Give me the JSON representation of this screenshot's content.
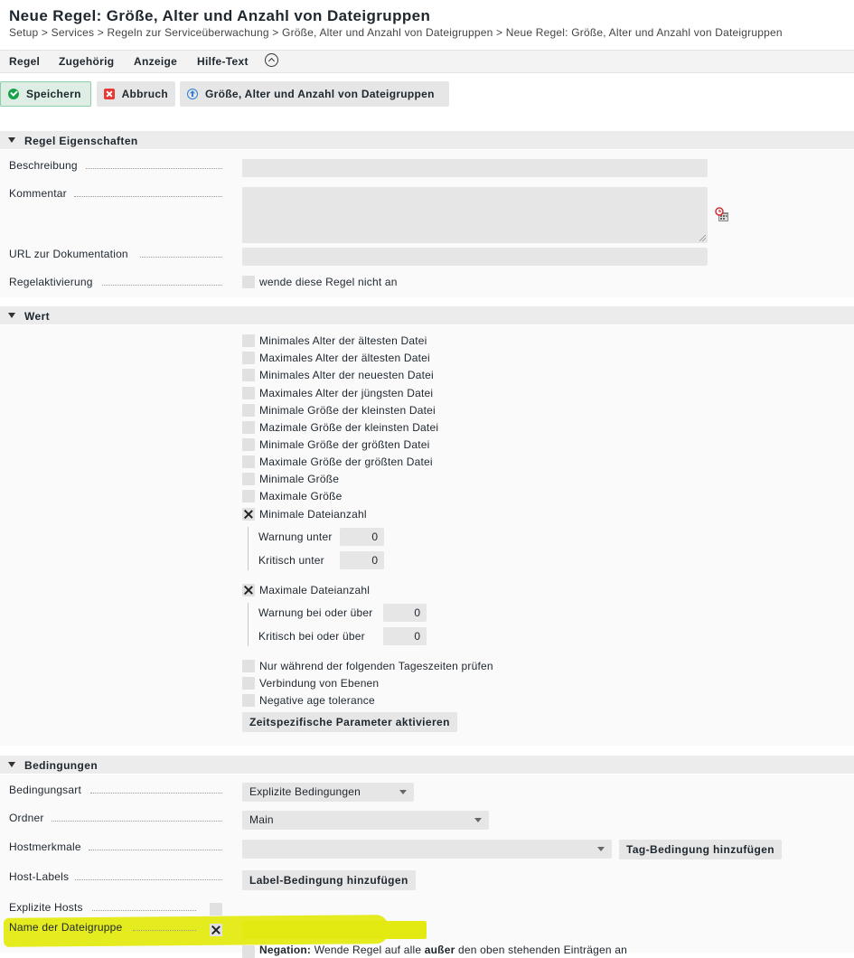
{
  "page": {
    "title": "Neue Regel: Größe, Alter und Anzahl von Dateigruppen",
    "breadcrumb": "Setup > Services > Regeln zur Serviceüberwachung > Größe, Alter und Anzahl von Dateigruppen > Neue Regel: Größe, Alter und Anzahl von Dateigruppen"
  },
  "menu": {
    "items": [
      "Regel",
      "Zugehörig",
      "Anzeige",
      "Hilfe-Text"
    ]
  },
  "toolbar": {
    "save_label": "Speichern",
    "cancel_label": "Abbruch",
    "parent_label": "Größe, Alter und Anzahl von Dateigruppen"
  },
  "properties": {
    "header": "Regel Eigenschaften",
    "description_label": "Beschreibung",
    "description_value": "",
    "comment_label": "Kommentar",
    "comment_value": "",
    "url_label": "URL zur Dokumentation",
    "url_value": "",
    "activation_label": "Regelaktivierung",
    "activation_checkbox": "wende diese Regel nicht an"
  },
  "value": {
    "header": "Wert",
    "options": [
      {
        "label": "Minimales Alter der ältesten Datei",
        "checked": false
      },
      {
        "label": "Maximales Alter der ältesten Datei",
        "checked": false
      },
      {
        "label": "Minimales Alter der neuesten Datei",
        "checked": false
      },
      {
        "label": "Maximales Alter der jüngsten Datei",
        "checked": false
      },
      {
        "label": "Minimale Größe der kleinsten Datei",
        "checked": false
      },
      {
        "label": "Mazimale Größe der kleinsten Datei",
        "checked": false
      },
      {
        "label": "Minimale Größe der größten Datei",
        "checked": false
      },
      {
        "label": "Maximale Größe der größten Datei",
        "checked": false
      },
      {
        "label": "Minimale Größe",
        "checked": false
      },
      {
        "label": "Maximale Größe",
        "checked": false
      }
    ],
    "min_count": {
      "label": "Minimale Dateianzahl",
      "checked": true,
      "warn_label": "Warnung unter",
      "warn_value": "0",
      "crit_label": "Kritisch unter",
      "crit_value": "0"
    },
    "max_count": {
      "label": "Maximale Dateianzahl",
      "checked": true,
      "warn_label": "Warnung bei oder über",
      "warn_value": "0",
      "crit_label": "Kritisch bei oder über",
      "crit_value": "0"
    },
    "extra_options": [
      {
        "label": "Nur während der folgenden Tageszeiten prüfen",
        "checked": false
      },
      {
        "label": "Verbindung von Ebenen",
        "checked": false
      },
      {
        "label": "Negative age tolerance",
        "checked": false
      }
    ],
    "timespecific_button": "Zeitspezifische Parameter aktivieren"
  },
  "conditions": {
    "header": "Bedingungen",
    "type_label": "Bedingungsart",
    "type_value": "Explizite Bedingungen",
    "folder_label": "Ordner",
    "folder_value": "Main",
    "hosttags_label": "Hostmerkmale",
    "hosttags_value": "",
    "add_tag_button": "Tag-Bedingung hinzufügen",
    "hostlabels_label": "Host-Labels",
    "add_label_button": "Label-Bedingung hinzufügen",
    "explicit_hosts_label": "Explizite Hosts",
    "explicit_hosts_checked": false,
    "filegroup_label": "Name der Dateigruppe",
    "filegroup_checked": true,
    "filegroup_value": "",
    "negation_bold": "Negation:",
    "negation_text1": "Wende Regel auf alle",
    "negation_bold2": "außer",
    "negation_text2": "den oben stehenden Einträgen an"
  },
  "colors": {
    "highlight": "#e3ea12",
    "save_border": "#8fcfa8",
    "section_header": "#ececec"
  }
}
